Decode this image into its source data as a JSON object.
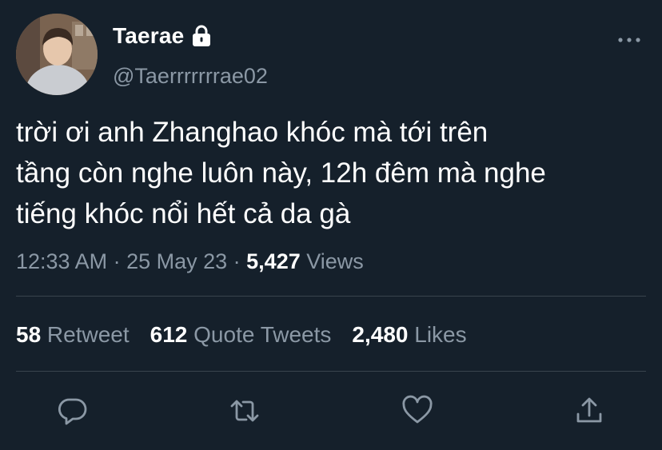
{
  "user": {
    "display_name": "Taerae",
    "handle": "@Taerrrrrrrae02"
  },
  "tweet": {
    "text": "trời ơi anh Zhanghao khóc mà tới trên\ntầng còn nghe luôn này, 12h đêm mà nghe\ntiếng khóc nổi hết cả da gà",
    "time": "12:33 AM",
    "sep1": " · ",
    "date": "25 May 23",
    "sep2": " · ",
    "views_count": "5,427",
    "views_label": " Views"
  },
  "stats": {
    "retweets_count": "58",
    "retweets_label": " Retweet",
    "quotes_count": "612",
    "quotes_label": " Quote Tweets",
    "likes_count": "2,480",
    "likes_label": " Likes"
  },
  "icons": {
    "lock": "lock-icon",
    "more": "more-horizontal-icon",
    "reply": "reply-icon",
    "retweet": "retweet-icon",
    "like": "heart-icon",
    "share": "share-icon"
  },
  "colors": {
    "background": "#15202b",
    "primary_text": "#ffffff",
    "secondary_text": "#8b98a5",
    "divider": "#38444d"
  }
}
